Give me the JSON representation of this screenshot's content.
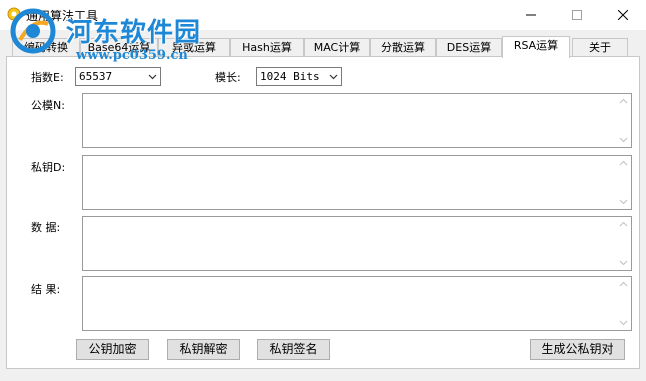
{
  "window": {
    "title": "通用算法工具",
    "min_icon": "minimize-icon",
    "max_icon": "maximize-icon",
    "close_icon": "close-icon"
  },
  "watermark": {
    "title": "河东软件园",
    "url": "www.pc0359.cn"
  },
  "tabs": [
    {
      "label": "编码转换"
    },
    {
      "label": "Base64运算"
    },
    {
      "label": "异或运算"
    },
    {
      "label": "Hash运算"
    },
    {
      "label": "MAC计算"
    },
    {
      "label": "分散运算"
    },
    {
      "label": "DES运算"
    },
    {
      "label": "RSA运算",
      "active": true
    },
    {
      "label": "关于"
    }
  ],
  "form": {
    "exponent_label": "指数E:",
    "exponent_value": "65537",
    "modlen_label": "模长:",
    "modlen_value": "1024 Bits",
    "modulus_label": "公模N:",
    "modulus_value": "",
    "private_label": "私钥D:",
    "private_value": "",
    "data_label": "数  据:",
    "data_value": "",
    "result_label": "结  果:",
    "result_value": ""
  },
  "buttons": {
    "pub_encrypt": "公钥加密",
    "priv_decrypt": "私钥解密",
    "priv_sign": "私钥签名",
    "gen_keypair": "生成公私钥对"
  },
  "colors": {
    "watermark": "#1e88d6",
    "panel": "#ffffff",
    "window_bg": "#f0f0f0"
  }
}
